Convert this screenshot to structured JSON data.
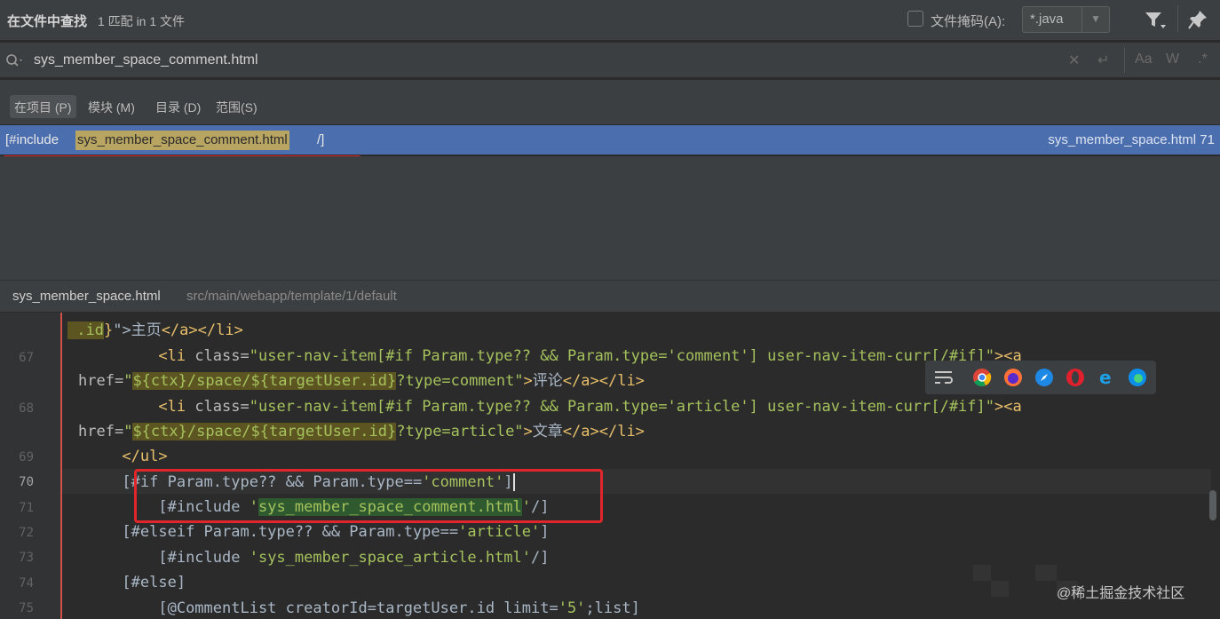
{
  "titlebar": {
    "title": "在文件中查找",
    "match_count": "1 匹配 in 1 文件",
    "file_mask_label": "文件掩码(A):",
    "file_mask_value": "*.java"
  },
  "search": {
    "query": "sys_member_space_comment.html"
  },
  "scope_tabs": [
    {
      "label": "在项目 (P)"
    },
    {
      "label": "模块 (M)"
    },
    {
      "label": "目录 (D)"
    },
    {
      "label": "范围(S)"
    }
  ],
  "result": {
    "prefix": "[#include",
    "match": "sys_member_space_comment.html",
    "suffix": "/]",
    "file_ref": "sys_member_space.html 71"
  },
  "preview": {
    "file": "sys_member_space.html",
    "path": "src/main/webapp/template/1/default"
  },
  "gutter_numbers": [
    "67",
    "68",
    "69",
    "70",
    "71",
    "72",
    "73",
    "74",
    "75"
  ],
  "watermark": "@稀土掘金技术社区",
  "colors": {
    "selection": "#4b6eaf",
    "match_highlight": "#b8a562",
    "annotation_red": "#e0252b"
  }
}
